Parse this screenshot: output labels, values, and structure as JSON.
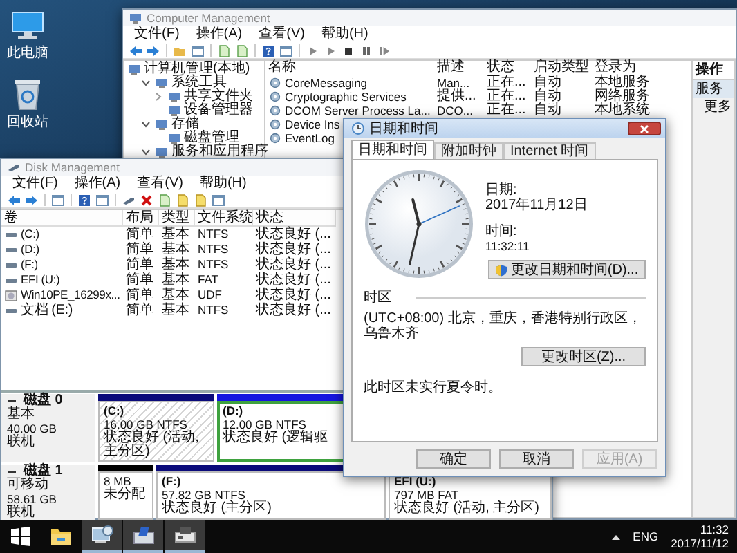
{
  "desktop_icons": [
    {
      "kind": "computer",
      "label": "此电脑"
    },
    {
      "kind": "recycle-bin",
      "label": "回收站"
    }
  ],
  "computer_management": {
    "title": "Computer Management",
    "menu": [
      "文件(F)",
      "操作(A)",
      "查看(V)",
      "帮助(H)"
    ],
    "tree": [
      {
        "label": "计算机管理(本地)",
        "children": [
          {
            "label": "系统工具",
            "expanded": true,
            "children": [
              {
                "label": "共享文件夹",
                "expanded": false
              },
              {
                "label": "设备管理器"
              }
            ]
          },
          {
            "label": "存储",
            "expanded": true,
            "children": [
              {
                "label": "磁盘管理"
              }
            ]
          },
          {
            "label": "服务和应用程序",
            "expanded": true
          }
        ]
      }
    ],
    "columns": [
      "名称",
      "描述",
      "状态",
      "启动类型",
      "登录为"
    ],
    "rows": [
      [
        "CoreMessaging",
        "Man...",
        "正在...",
        "自动",
        "本地服务"
      ],
      [
        "Cryptographic Services",
        "提供...",
        "正在...",
        "自动",
        "网络服务"
      ],
      [
        "DCOM Server Process La...",
        "DCO...",
        "正在...",
        "自动",
        "本地系统"
      ],
      [
        "Device Ins"
      ],
      [
        "EventLog"
      ]
    ],
    "actions": {
      "heading": "操作",
      "section": "服务",
      "items": [
        "更多"
      ]
    }
  },
  "disk_management": {
    "title": "Disk Management",
    "menu": [
      "文件(F)",
      "操作(A)",
      "查看(V)",
      "帮助(H)"
    ],
    "columns": [
      "卷",
      "布局",
      "类型",
      "文件系统",
      "状态"
    ],
    "volumes": [
      {
        "kind": "drive",
        "cells": [
          "(C:)",
          "简单",
          "基本",
          "NTFS",
          "状态良好 (..."
        ]
      },
      {
        "kind": "drive",
        "cells": [
          "(D:)",
          "简单",
          "基本",
          "NTFS",
          "状态良好 (..."
        ]
      },
      {
        "kind": "drive",
        "cells": [
          "(F:)",
          "简单",
          "基本",
          "NTFS",
          "状态良好 (..."
        ]
      },
      {
        "kind": "drive",
        "cells": [
          "EFI (U:)",
          "简单",
          "基本",
          "FAT",
          "状态良好 (..."
        ]
      },
      {
        "kind": "disc",
        "cells": [
          "Win10PE_16299x...",
          "简单",
          "基本",
          "UDF",
          "状态良好 (..."
        ]
      },
      {
        "kind": "drive",
        "cells": [
          "文档 (E:)",
          "简单",
          "基本",
          "NTFS",
          "状态良好 (..."
        ]
      }
    ],
    "disks": [
      {
        "name": "磁盘 0",
        "type": "基本",
        "size": "40.00 GB",
        "status": "联机",
        "partitions": [
          {
            "kind": "primary",
            "selected": true,
            "label": "(C:)",
            "size": "16.00 GB NTFS",
            "status": "状态良好 (活动, 主分区)"
          },
          {
            "kind": "logical",
            "selected": false,
            "label": "(D:)",
            "size": "12.00 GB NTFS",
            "status": "状态良好 (逻辑驱"
          }
        ]
      },
      {
        "name": "磁盘 1",
        "type": "可移动",
        "size": "58.61 GB",
        "status": "联机",
        "partitions": [
          {
            "kind": "unallocated",
            "selected": false,
            "size": "8 MB",
            "status": "未分配"
          },
          {
            "kind": "primary",
            "selected": false,
            "label": "(F:)",
            "size": "57.82 GB NTFS",
            "status": "状态良好 (主分区)"
          },
          {
            "kind": "primary",
            "selected": false,
            "label": "EFI (U:)",
            "size": "797 MB FAT",
            "status": "状态良好 (活动, 主分区)"
          }
        ]
      }
    ]
  },
  "date_time_dialog": {
    "title": "日期和时间",
    "tabs": [
      {
        "label": "日期和时间",
        "selected": true
      },
      {
        "label": "附加时钟",
        "selected": false
      },
      {
        "label": "Internet 时间",
        "selected": false
      }
    ],
    "date_label": "日期:",
    "date": "2017年11月12日",
    "time_label": "时间:",
    "time": "11:32:11",
    "change_datetime_button": "更改日期和时间(D)...",
    "timezone_heading": "时区",
    "timezone": "(UTC+08:00) 北京，重庆，香港特别行政区，乌鲁木齐",
    "change_timezone_button": "更改时区(Z)...",
    "dst_note": "此时区未实行夏令时。",
    "buttons": [
      {
        "label": "确定",
        "disabled": false
      },
      {
        "label": "取消",
        "disabled": false
      },
      {
        "label": "应用(A)",
        "disabled": true
      }
    ]
  },
  "taskbar": {
    "apps": [
      {
        "kind": "file-explorer",
        "open": false
      },
      {
        "kind": "computer-management",
        "open": true
      },
      {
        "kind": "disk-management",
        "open": true
      },
      {
        "kind": "drive-tool",
        "open": true
      }
    ],
    "language": "ENG",
    "time": "11:32",
    "date": "2017/11/12"
  }
}
